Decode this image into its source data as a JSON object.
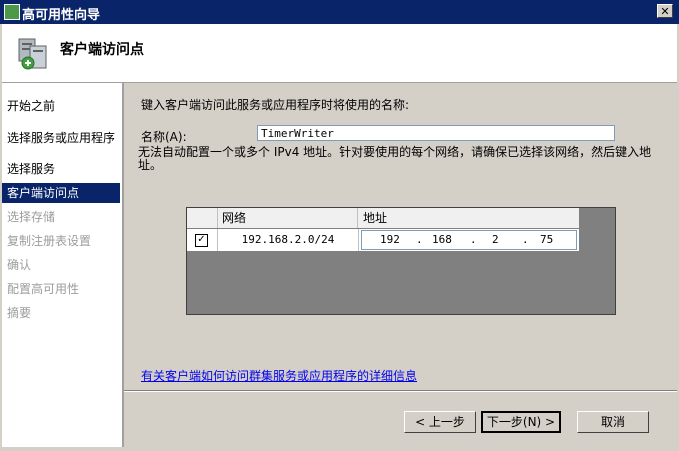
{
  "window": {
    "title": "高可用性向导",
    "close_glyph": "✕"
  },
  "header": {
    "title": "客户端访问点"
  },
  "nav": {
    "items": [
      {
        "label": "开始之前",
        "state": "normal"
      },
      {
        "label": "选择服务或应用程序",
        "state": "normal"
      },
      {
        "label": "选择服务",
        "state": "normal"
      },
      {
        "label": "客户端访问点",
        "state": "active"
      },
      {
        "label": "选择存储",
        "state": "disabled"
      },
      {
        "label": "复制注册表设置",
        "state": "disabled"
      },
      {
        "label": "确认",
        "state": "disabled"
      },
      {
        "label": "配置高可用性",
        "state": "disabled"
      },
      {
        "label": "摘要",
        "state": "disabled"
      }
    ]
  },
  "main": {
    "intro": "键入客户端访问此服务或应用程序时将使用的名称:",
    "name_label": "名称(A):",
    "name_value": "TimerWriter",
    "note": "无法自动配置一个或多个 IPv4 地址。针对要使用的每个网络，请确保已选择该网络，然后键入地址。",
    "grid": {
      "col_network": "网络",
      "col_address": "地址",
      "rows": [
        {
          "checked": true,
          "check_glyph": "✓",
          "network": "192.168.2.0/24",
          "address": [
            "192",
            "168",
            "2",
            "75"
          ]
        }
      ]
    },
    "help_link": "有关客户端如何访问群集服务或应用程序的详细信息"
  },
  "footer": {
    "back_label": "< 上一步",
    "next_label": "下一步(N) >",
    "cancel_label": "取消"
  }
}
